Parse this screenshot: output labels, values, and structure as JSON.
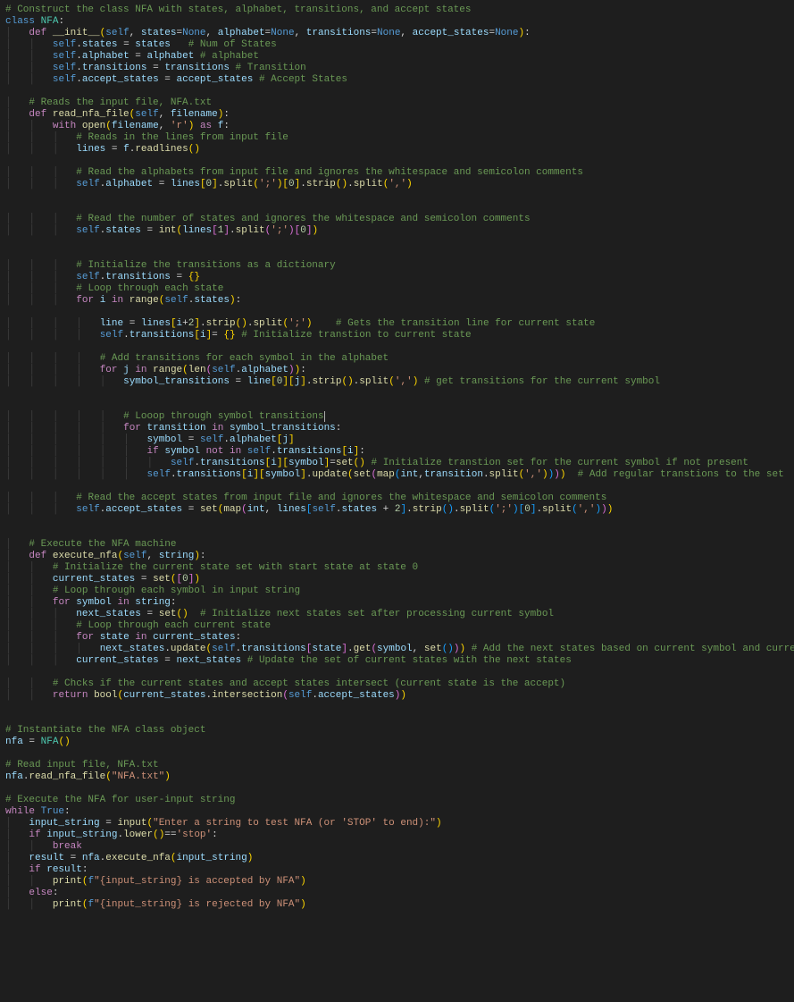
{
  "code": {
    "lang": "python",
    "lines": [
      "# Construct the class NFA with states, alphabet, transitions, and accept states",
      "class NFA:",
      "    def __init__(self, states=None, alphabet=None, transitions=None, accept_states=None):",
      "        self.states = states   # Num of States",
      "        self.alphabet = alphabet # alphabet",
      "        self.transitions = transitions # Transition",
      "        self.accept_states = accept_states # Accept States",
      "",
      "    # Reads the input file, NFA.txt",
      "    def read_nfa_file(self, filename):",
      "        with open(filename, 'r') as f:",
      "            # Reads in the lines from input file",
      "            lines = f.readlines()",
      "",
      "            # Read the alphabets from input file and ignores the whitespace and semicolon comments",
      "            self.alphabet = lines[0].split(';')[0].strip().split(',')",
      "",
      "",
      "            # Read the number of states and ignores the whitespace and semicolon comments",
      "            self.states = int(lines[1].split(';')[0])",
      "",
      "",
      "            # Initialize the transitions as a dictionary",
      "            self.transitions = {}",
      "            # Loop through each state",
      "            for i in range(self.states):",
      "",
      "                line = lines[i+2].strip().split(';')    # Gets the transition line for current state",
      "                self.transitions[i]= {} # Initialize transtion to current state",
      "",
      "                # Add transitions for each symbol in the alphabet",
      "                for j in range(len(self.alphabet)):",
      "                    symbol_transitions = line[0][j].strip().split(',') # get transitions for the current symbol",
      "",
      "",
      "                    # Looop through symbol transitions",
      "                    for transition in symbol_transitions:",
      "                        symbol = self.alphabet[j]",
      "                        if symbol not in self.transitions[i]:",
      "                            self.transitions[i][symbol]=set() # Initialize transtion set for the current symbol if not present",
      "                        self.transitions[i][symbol].update(set(map(int,transition.split(','))))  # Add regular transtions to the set",
      "",
      "            # Read the accept states from input file and ignores the whitespace and semicolon comments",
      "            self.accept_states = set(map(int, lines[self.states + 2].strip().split(';')[0].split(',')))",
      "",
      "",
      "    # Execute the NFA machine",
      "    def execute_nfa(self, string):",
      "        # Initialize the current state set with start state at state 0",
      "        current_states = set([0])",
      "        # Loop through each symbol in input string",
      "        for symbol in string:",
      "            next_states = set()  # Initialize next states set after processing current symbol",
      "            # Loop through each current state",
      "            for state in current_states:",
      "                next_states.update(self.transitions[state].get(symbol, set())) # Add the next states based on current symbol and current state",
      "            current_states = next_states # Update the set of current states with the next states",
      "",
      "        # Chcks if the current states and accept states intersect (current state is the accept)",
      "        return bool(current_states.intersection(self.accept_states))",
      "",
      "",
      "# Instantiate the NFA class object",
      "nfa = NFA()",
      "",
      "# Read input file, NFA.txt",
      "nfa.read_nfa_file(\"NFA.txt\")",
      "",
      "# Execute the NFA for user-input string",
      "while True:",
      "    input_string = input(\"Enter a string to test NFA (or 'STOP' to end):\")",
      "    if input_string.lower()=='stop':",
      "        break",
      "    result = nfa.execute_nfa(input_string)",
      "    if result:",
      "        print(f\"{input_string} is accepted by NFA\")",
      "    else:",
      "        print(f\"{input_string} is rejected by NFA\")"
    ],
    "cursor_line": 35,
    "cursor_col": 55,
    "indent_guides": true
  },
  "colors": {
    "background": "#1e1e1e",
    "comment": "#6a9955",
    "keyword": "#569cd6",
    "control": "#c586c0",
    "function": "#dcdcaa",
    "class": "#4ec9b0",
    "variable": "#9cdcfe",
    "string": "#ce9178",
    "number": "#b5cea8",
    "bracket1": "#ffd700",
    "bracket2": "#da70d6",
    "bracket3": "#179fff"
  }
}
